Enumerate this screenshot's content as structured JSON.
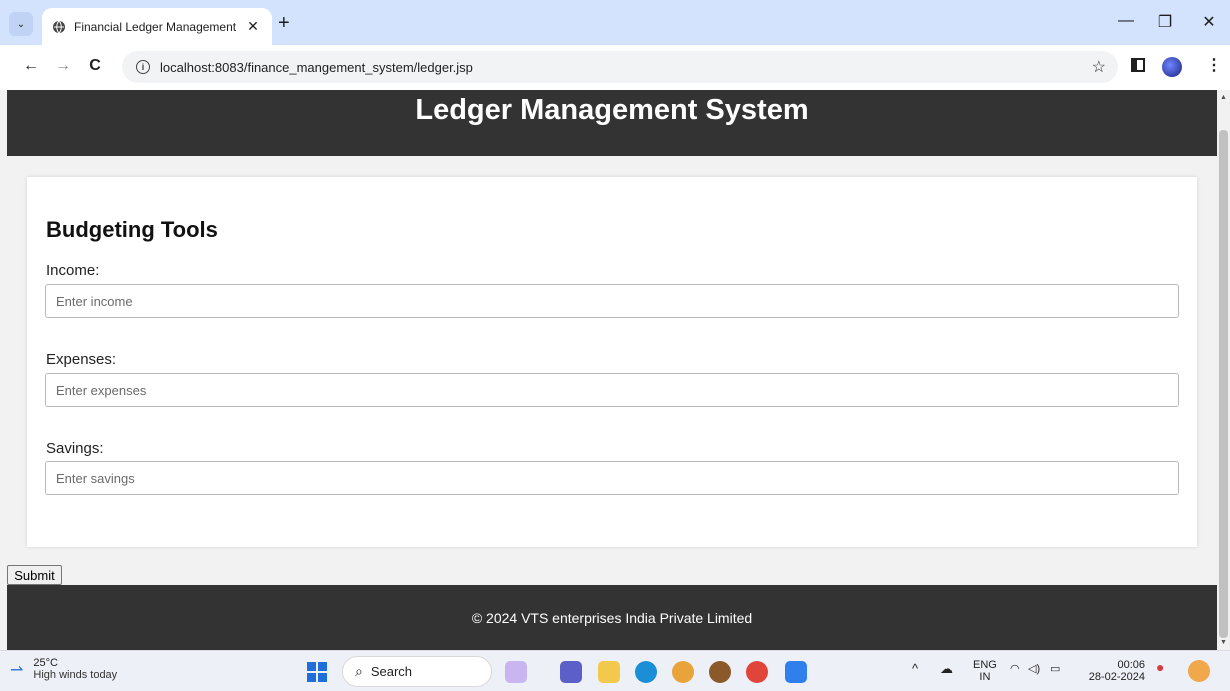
{
  "browser": {
    "tab_title": "Financial Ledger Management",
    "tab_close": "✕",
    "new_tab": "+",
    "url": "localhost:8083/finance_mangement_system/ledger.jsp",
    "window": {
      "minimize": "—",
      "restore": "❐",
      "close": "✕"
    },
    "nav": {
      "back": "←",
      "forward": "→",
      "reload": "C"
    },
    "star": "☆",
    "menu": "⋮"
  },
  "page": {
    "header_title": "Ledger Management System",
    "section_title": "Budgeting Tools",
    "fields": [
      {
        "label": "Income:",
        "placeholder": "Enter income"
      },
      {
        "label": "Expenses:",
        "placeholder": "Enter expenses"
      },
      {
        "label": "Savings:",
        "placeholder": "Enter savings"
      }
    ],
    "submit_label": "Submit",
    "footer_text": "© 2024 VTS enterprises India Private Limited"
  },
  "taskbar": {
    "weather_temp": "25°C",
    "weather_desc": "High winds today",
    "search_label": "Search",
    "lang_top": "ENG",
    "lang_bottom": "IN",
    "time": "00:06",
    "date": "28-02-2024",
    "colors": {
      "start": "#1e6fd9",
      "accent": "#d3e3fd"
    }
  }
}
